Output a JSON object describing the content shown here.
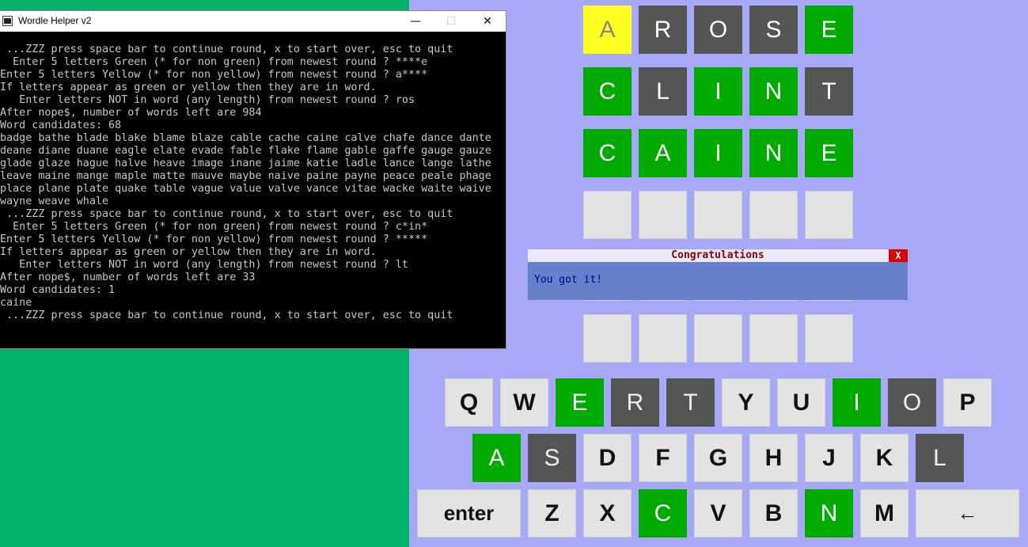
{
  "console_window": {
    "title": "Wordle Helper v2",
    "buttons": {
      "minimize": "—",
      "maximize": "☐",
      "close": "✕"
    },
    "lines": [
      " ...ZZZ press space bar to continue round, x to start over, esc to quit",
      "  Enter 5 letters Green (* for non green) from newest round ? ****e",
      "Enter 5 letters Yellow (* for non yellow) from newest round ? a****",
      "If letters appear as green or yellow then they are in word.",
      "   Enter letters NOT in word (any length) from newest round ? ros",
      "After nope$, number of words left are 984",
      "Word candidates: 68",
      "badge bathe blade blake blame blaze cable cache caine calve chafe dance dante",
      "deane diane duane eagle elate evade fable flake flame gable gaffe gauge gauze",
      "glade glaze hague halve heave image inane jaime katie ladle lance lange lathe",
      "leave maine mange maple matte mauve maybe naive paine payne peace peale phage",
      "place plane plate quake table vague value valve vance vitae wacke waite waive",
      "wayne weave whale",
      " ...ZZZ press space bar to continue round, x to start over, esc to quit",
      "  Enter 5 letters Green (* for non green) from newest round ? c*in*",
      "Enter 5 letters Yellow (* for non yellow) from newest round ? *****",
      "If letters appear as green or yellow then they are in word.",
      "   Enter letters NOT in word (any length) from newest round ? lt",
      "After nope$, number of words left are 33",
      "Word candidates: 1",
      "caine",
      " ...ZZZ press space bar to continue round, x to start over, esc to quit"
    ]
  },
  "board": {
    "rows": [
      [
        {
          "letter": "A",
          "state": "yellow"
        },
        {
          "letter": "R",
          "state": "gray"
        },
        {
          "letter": "O",
          "state": "gray"
        },
        {
          "letter": "S",
          "state": "gray"
        },
        {
          "letter": "E",
          "state": "green"
        }
      ],
      [
        {
          "letter": "C",
          "state": "green"
        },
        {
          "letter": "L",
          "state": "gray"
        },
        {
          "letter": "I",
          "state": "green"
        },
        {
          "letter": "N",
          "state": "green"
        },
        {
          "letter": "T",
          "state": "gray"
        }
      ],
      [
        {
          "letter": "C",
          "state": "green"
        },
        {
          "letter": "A",
          "state": "green"
        },
        {
          "letter": "I",
          "state": "green"
        },
        {
          "letter": "N",
          "state": "green"
        },
        {
          "letter": "E",
          "state": "green"
        }
      ],
      [
        {
          "letter": "",
          "state": "empty"
        },
        {
          "letter": "",
          "state": "empty"
        },
        {
          "letter": "",
          "state": "empty"
        },
        {
          "letter": "",
          "state": "empty"
        },
        {
          "letter": "",
          "state": "empty"
        }
      ],
      [
        {
          "letter": "",
          "state": "empty"
        },
        {
          "letter": "",
          "state": "empty"
        },
        {
          "letter": "",
          "state": "empty"
        },
        {
          "letter": "",
          "state": "empty"
        },
        {
          "letter": "",
          "state": "empty"
        }
      ],
      [
        {
          "letter": "",
          "state": "empty"
        },
        {
          "letter": "",
          "state": "empty"
        },
        {
          "letter": "",
          "state": "empty"
        },
        {
          "letter": "",
          "state": "empty"
        },
        {
          "letter": "",
          "state": "empty"
        }
      ]
    ]
  },
  "keyboard": {
    "rows": [
      [
        {
          "label": "Q",
          "state": "default"
        },
        {
          "label": "W",
          "state": "default"
        },
        {
          "label": "E",
          "state": "green"
        },
        {
          "label": "R",
          "state": "gray"
        },
        {
          "label": "T",
          "state": "gray"
        },
        {
          "label": "Y",
          "state": "default"
        },
        {
          "label": "U",
          "state": "default"
        },
        {
          "label": "I",
          "state": "green"
        },
        {
          "label": "O",
          "state": "gray"
        },
        {
          "label": "P",
          "state": "default"
        }
      ],
      [
        {
          "label": "A",
          "state": "green"
        },
        {
          "label": "S",
          "state": "gray"
        },
        {
          "label": "D",
          "state": "default"
        },
        {
          "label": "F",
          "state": "default"
        },
        {
          "label": "G",
          "state": "default"
        },
        {
          "label": "H",
          "state": "default"
        },
        {
          "label": "J",
          "state": "default"
        },
        {
          "label": "K",
          "state": "default"
        },
        {
          "label": "L",
          "state": "gray"
        }
      ],
      [
        {
          "label": "enter",
          "state": "default"
        },
        {
          "label": "Z",
          "state": "default"
        },
        {
          "label": "X",
          "state": "default"
        },
        {
          "label": "C",
          "state": "green"
        },
        {
          "label": "V",
          "state": "default"
        },
        {
          "label": "B",
          "state": "default"
        },
        {
          "label": "N",
          "state": "green"
        },
        {
          "label": "M",
          "state": "default"
        },
        {
          "label": "←",
          "state": "default"
        }
      ]
    ]
  },
  "dialog": {
    "title": "Congratulations",
    "close_label": "X",
    "message": "You got it!"
  },
  "colors": {
    "desktop": "#00b16a",
    "game_bg": "#a8a8f8",
    "green": "#00aa00",
    "gray": "#555555",
    "yellow": "#ffff22",
    "empty": "#e3e3e3"
  }
}
